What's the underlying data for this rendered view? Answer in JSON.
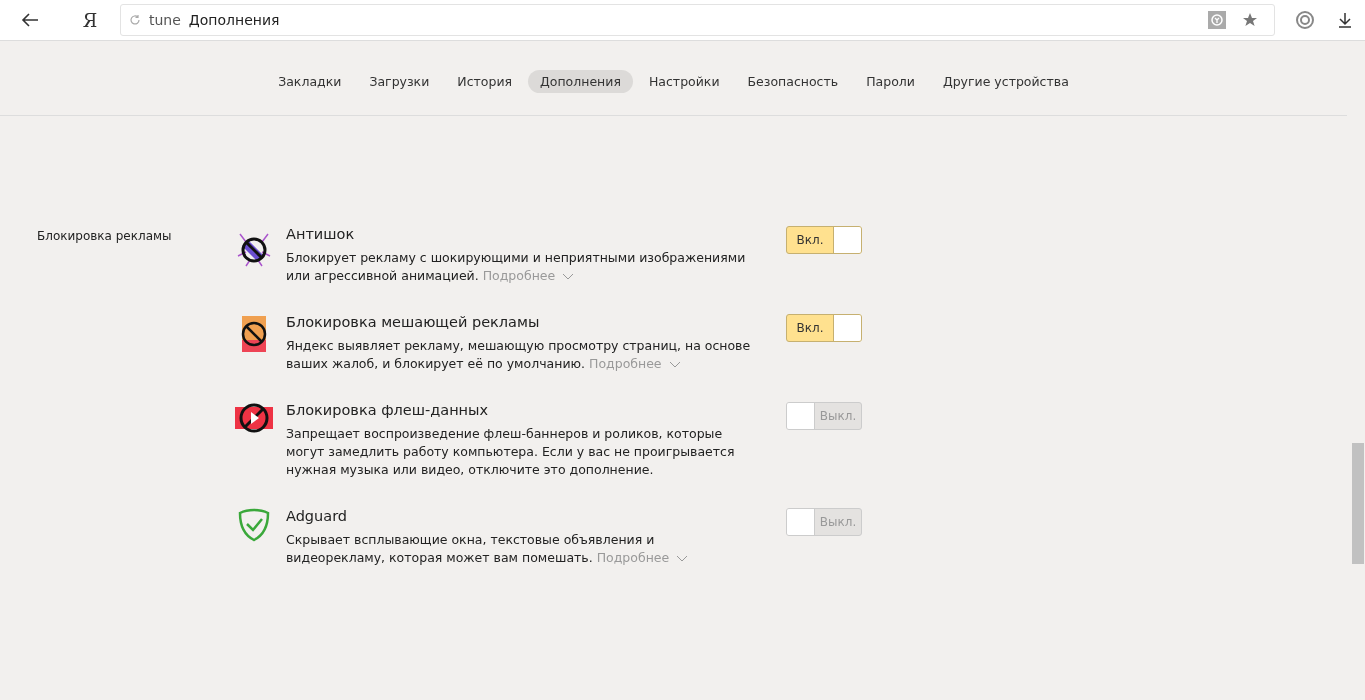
{
  "toolbar": {
    "logo": "Я",
    "address": {
      "prefix": "tune",
      "title": "Дополнения"
    }
  },
  "tabs": [
    {
      "label": "Закладки",
      "selected": false
    },
    {
      "label": "Загрузки",
      "selected": false
    },
    {
      "label": "История",
      "selected": false
    },
    {
      "label": "Дополнения",
      "selected": true
    },
    {
      "label": "Настройки",
      "selected": false
    },
    {
      "label": "Безопасность",
      "selected": false
    },
    {
      "label": "Пароли",
      "selected": false
    },
    {
      "label": "Другие устройства",
      "selected": false
    }
  ],
  "section": {
    "title": "Блокировка рекламы",
    "extensions": [
      {
        "kind": "antishock",
        "name": "Антишок",
        "description": "Блокирует рекламу с шокирующими и неприятными изображениями или агрессивной анимацией.",
        "more": "Подробнее",
        "on": true,
        "toggle_label": "Вкл."
      },
      {
        "kind": "annoying",
        "name": "Блокировка мешающей рекламы",
        "description": "Яндекс выявляет рекламу, мешающую просмотру страниц, на основе ваших жалоб, и блокирует её по умолчанию.",
        "more": "Подробнее",
        "on": true,
        "toggle_label": "Вкл."
      },
      {
        "kind": "flash",
        "name": "Блокировка флеш-данных",
        "description": "Запрещает воспроизведение флеш-баннеров и роликов, которые могут замедлить работу компьютера. Если у вас не проигрывается нужная музыка или видео, отключите это дополнение.",
        "on": false,
        "toggle_label": "Выкл."
      },
      {
        "kind": "adguard",
        "name": "Adguard",
        "description": "Скрывает всплывающие окна, текстовые объявления и видеорекламу, которая может вам помешать.",
        "more": "Подробнее",
        "on": false,
        "toggle_label": "Выкл."
      }
    ]
  }
}
